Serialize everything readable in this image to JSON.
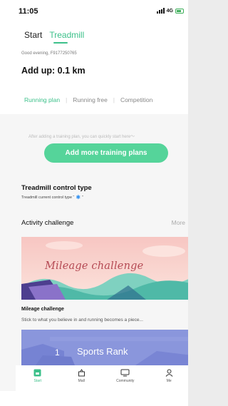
{
  "status_bar": {
    "time": "11:05",
    "network": "4G"
  },
  "header": {
    "tabs": [
      {
        "label": "Start"
      },
      {
        "label": "Treadmill"
      }
    ],
    "greeting": "Good evening,  F9177250765",
    "add_up": "Add up: 0.1 km",
    "plan_tabs": [
      {
        "label": "Running plan"
      },
      {
        "label": "Running free"
      },
      {
        "label": "Competition"
      }
    ]
  },
  "training": {
    "hint": "After adding a training plan, you can quickly start here～",
    "add_button": "Add more training plans"
  },
  "control": {
    "title": "Treadmill control type",
    "subtitle": "Treadmill current control type “",
    "subtitle_end": "”"
  },
  "activity": {
    "title": "Activity challenge",
    "more": "More",
    "banner_title": "Mileage challenge",
    "item_title": "Mileage challenge",
    "item_desc": "Stick to what you believe in and running becomes a piece..."
  },
  "rank": {
    "number": "1",
    "label": "Sports Rank"
  },
  "nav": {
    "items": [
      {
        "label": "Start",
        "icon": "home-icon"
      },
      {
        "label": "Mall",
        "icon": "shopping-bag-icon"
      },
      {
        "label": "Community",
        "icon": "chat-icon"
      },
      {
        "label": "Me",
        "icon": "person-icon"
      }
    ]
  },
  "colors": {
    "accent": "#3cc08a",
    "button": "#55d49a",
    "banner_text": "#b54a54",
    "rank_bg": "#8a96dc"
  }
}
